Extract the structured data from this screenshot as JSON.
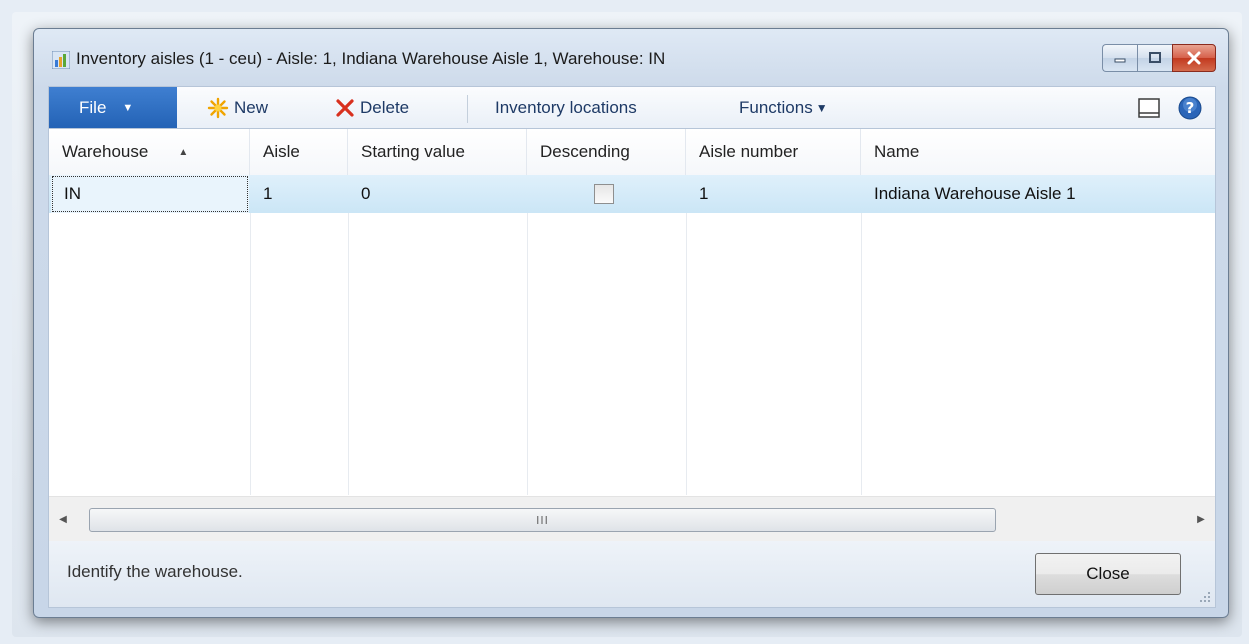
{
  "window": {
    "title": "Inventory aisles (1 - ceu) - Aisle: 1, Indiana Warehouse Aisle 1, Warehouse: IN"
  },
  "toolbar": {
    "file_label": "File",
    "new_label": "New",
    "delete_label": "Delete",
    "inventory_locations_label": "Inventory locations",
    "functions_label": "Functions"
  },
  "grid": {
    "columns": [
      "Warehouse",
      "Aisle",
      "Starting value",
      "Descending",
      "Aisle number",
      "Name"
    ],
    "sorted_column": "Warehouse",
    "rows": [
      {
        "warehouse": "IN",
        "aisle": "1",
        "starting_value": "0",
        "descending": false,
        "aisle_number": "1",
        "name": "Indiana Warehouse Aisle 1"
      }
    ]
  },
  "scrollbar": {
    "thumb_grip": "III"
  },
  "status": {
    "text": "Identify the warehouse.",
    "close_label": "Close"
  },
  "colors": {
    "file_button": "#2f6fc4",
    "selected_row": "#d6ecf9",
    "close_window_button": "#c9452a"
  },
  "icons": [
    "app-icon",
    "new-icon",
    "delete-icon",
    "list-view-icon",
    "help-icon",
    "minimize-icon",
    "maximize-icon",
    "close-icon"
  ]
}
